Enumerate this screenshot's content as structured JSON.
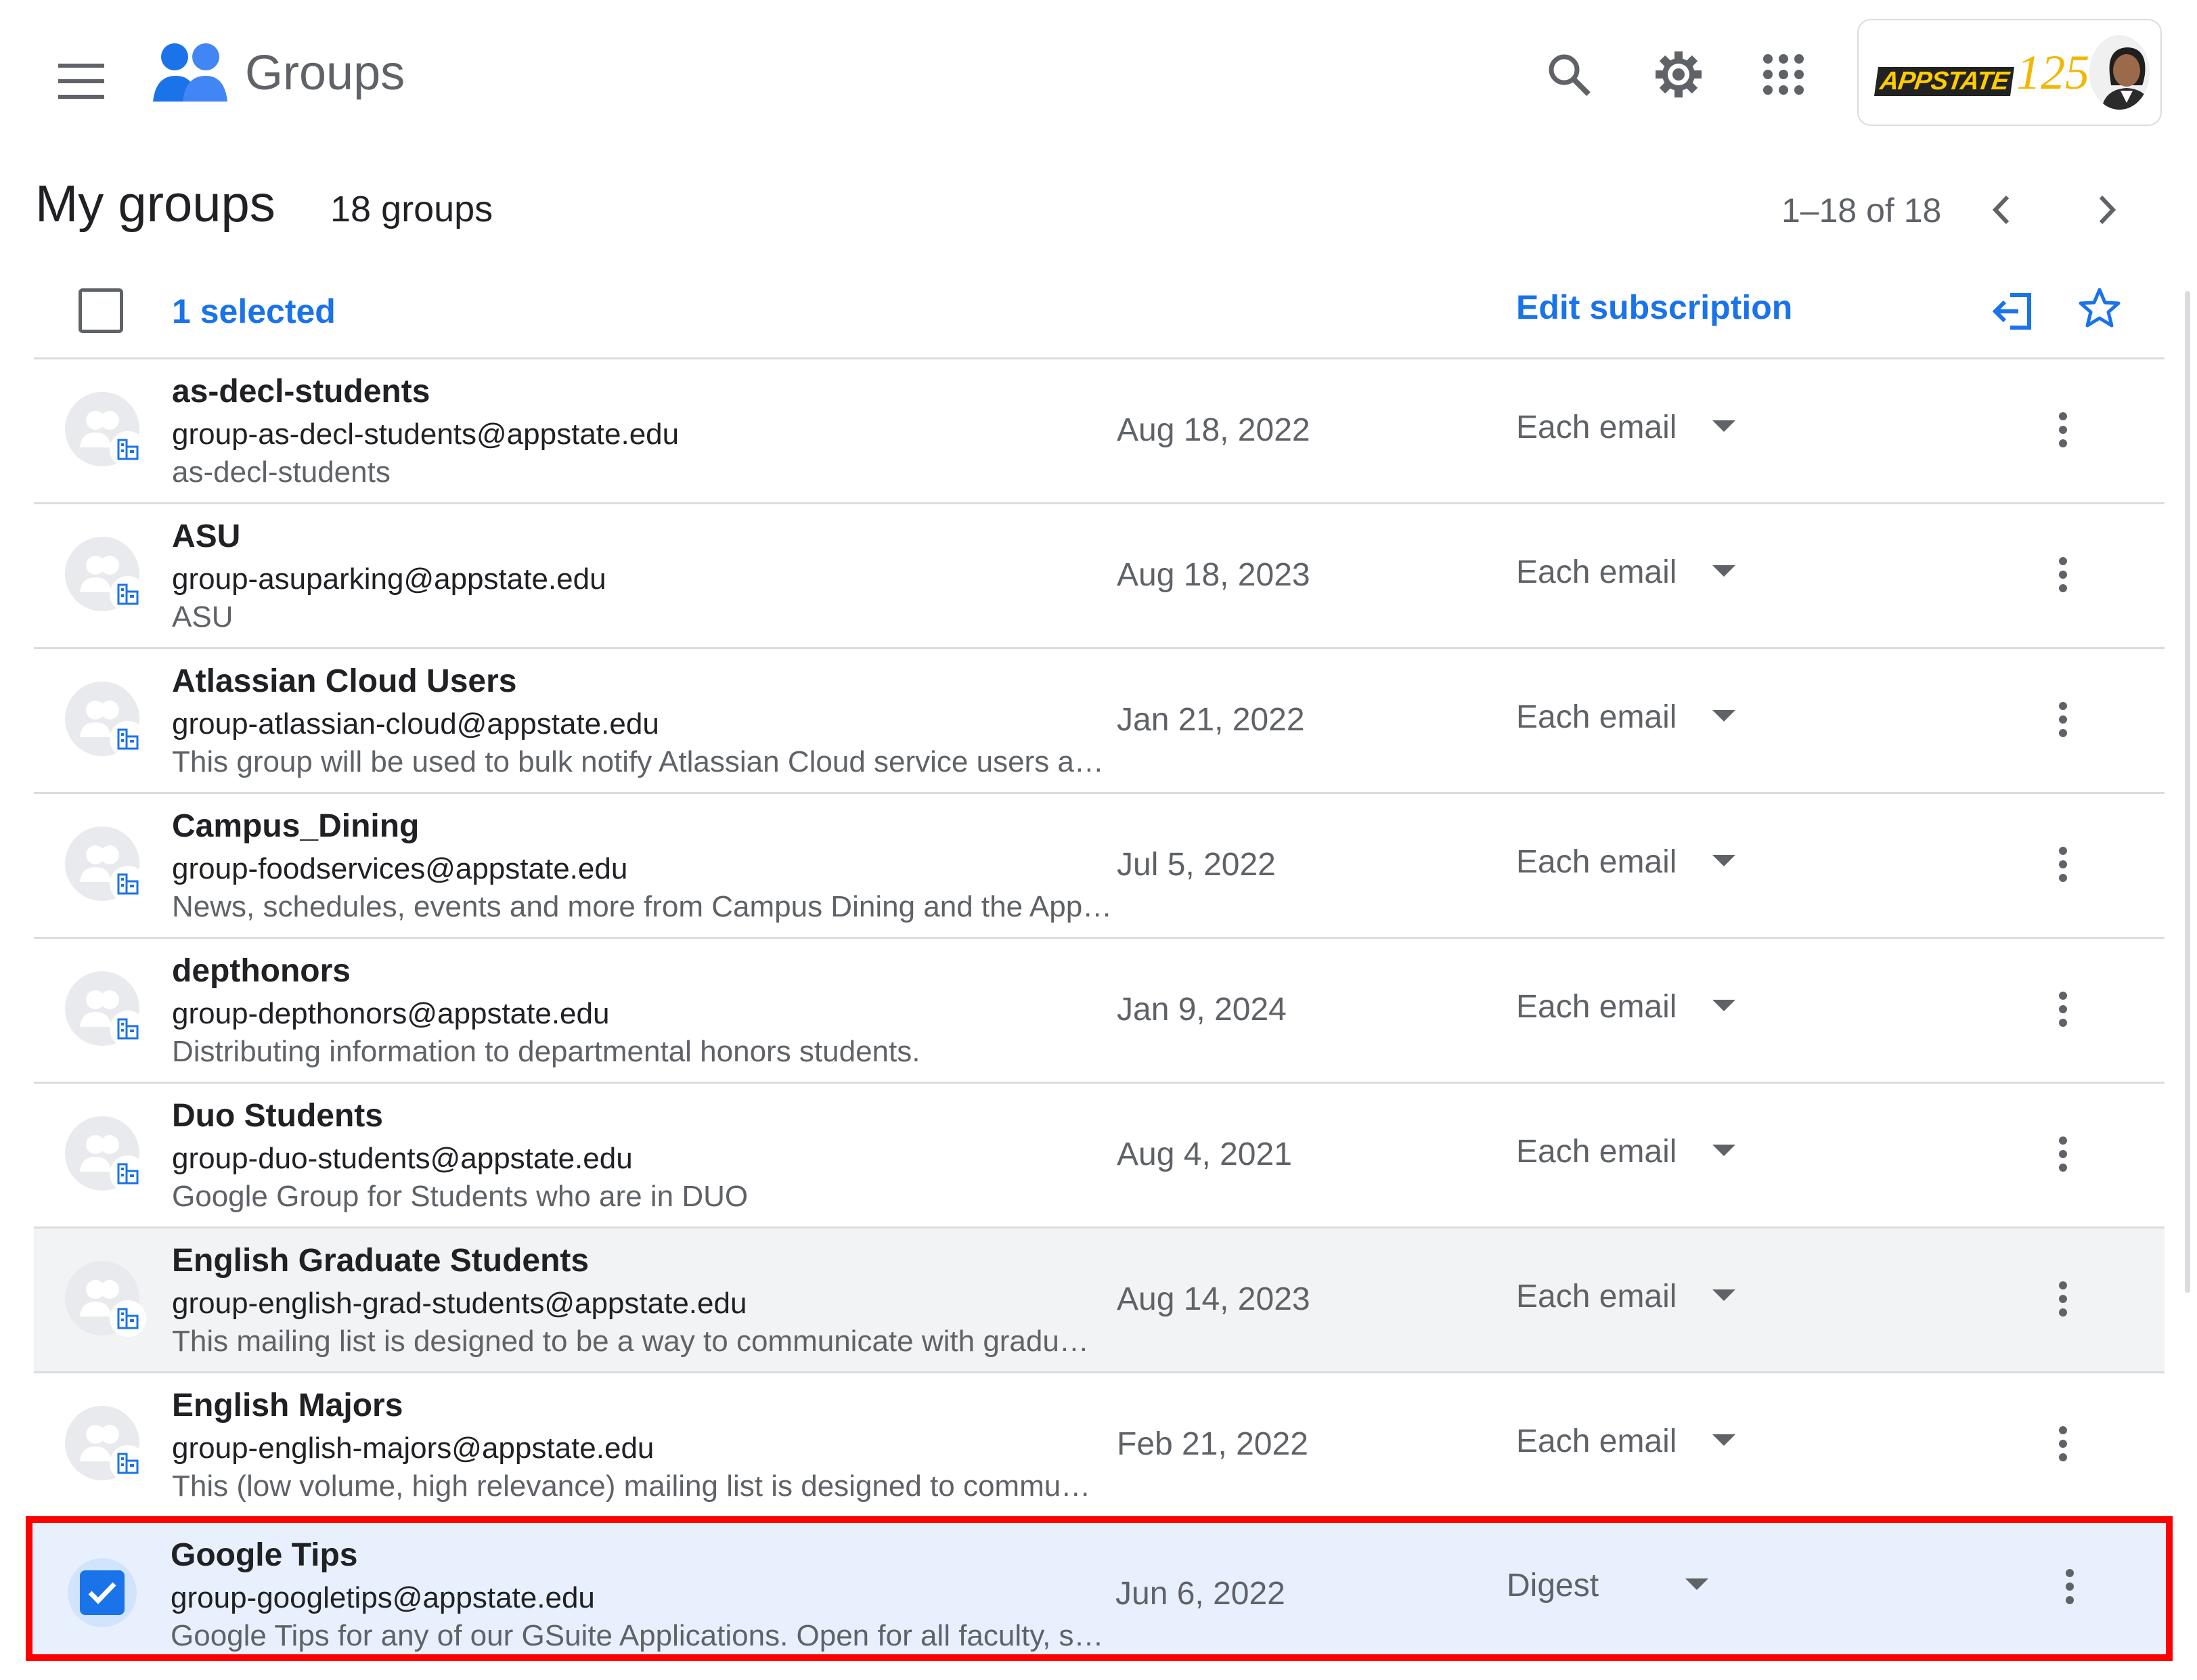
{
  "header": {
    "app_title": "Groups",
    "icons": {
      "menu": "hamburger-menu-icon",
      "logo": "groups-logo-icon",
      "search": "search-icon",
      "settings": "gear-icon",
      "apps": "apps-grid-icon"
    },
    "account": {
      "brand_text": "APPSTATE",
      "brand_number": "125"
    }
  },
  "subheader": {
    "title": "My groups",
    "count": "18 groups",
    "pager": "1–18 of 18"
  },
  "toolbar": {
    "selected_label": "1 selected",
    "edit_subscription": "Edit subscription"
  },
  "colors": {
    "accent": "#1a73e8",
    "selected_row": "#e8f0fe",
    "hover_row": "#f1f3f4",
    "highlight_border": "#ff0000"
  },
  "rows": [
    {
      "name": "as-decl-students",
      "email": "group-as-decl-students@appstate.edu",
      "desc": "as-decl-students",
      "date": "Aug 18, 2022",
      "subscription": "Each email"
    },
    {
      "name": "ASU",
      "email": "group-asuparking@appstate.edu",
      "desc": "ASU",
      "date": "Aug 18, 2023",
      "subscription": "Each email"
    },
    {
      "name": "Atlassian Cloud Users",
      "email": "group-atlassian-cloud@appstate.edu",
      "desc": "This group will be used to bulk notify Atlassian Cloud service users a…",
      "date": "Jan 21, 2022",
      "subscription": "Each email"
    },
    {
      "name": "Campus_Dining",
      "email": "group-foodservices@appstate.edu",
      "desc": "News, schedules, events and more from Campus Dining and the App…",
      "date": "Jul 5, 2022",
      "subscription": "Each email"
    },
    {
      "name": "depthonors",
      "email": "group-depthonors@appstate.edu",
      "desc": "Distributing information to departmental honors students.",
      "date": "Jan 9, 2024",
      "subscription": "Each email"
    },
    {
      "name": "Duo Students",
      "email": "group-duo-students@appstate.edu",
      "desc": "Google Group for Students who are in DUO",
      "date": "Aug 4, 2021",
      "subscription": "Each email"
    },
    {
      "name": "English Graduate Students",
      "email": "group-english-grad-students@appstate.edu",
      "desc": "This mailing list is designed to be a way to communicate with gradu…",
      "date": "Aug 14, 2023",
      "subscription": "Each email"
    },
    {
      "name": "English Majors",
      "email": "group-english-majors@appstate.edu",
      "desc": "This (low volume, high relevance) mailing list is designed to commu…",
      "date": "Feb 21, 2022",
      "subscription": "Each email"
    },
    {
      "name": "Google Tips",
      "email": "group-googletips@appstate.edu",
      "desc": "Google Tips for any of our GSuite Applications. Open for all faculty, s…",
      "date": "Jun 6, 2022",
      "subscription": "Digest"
    }
  ]
}
